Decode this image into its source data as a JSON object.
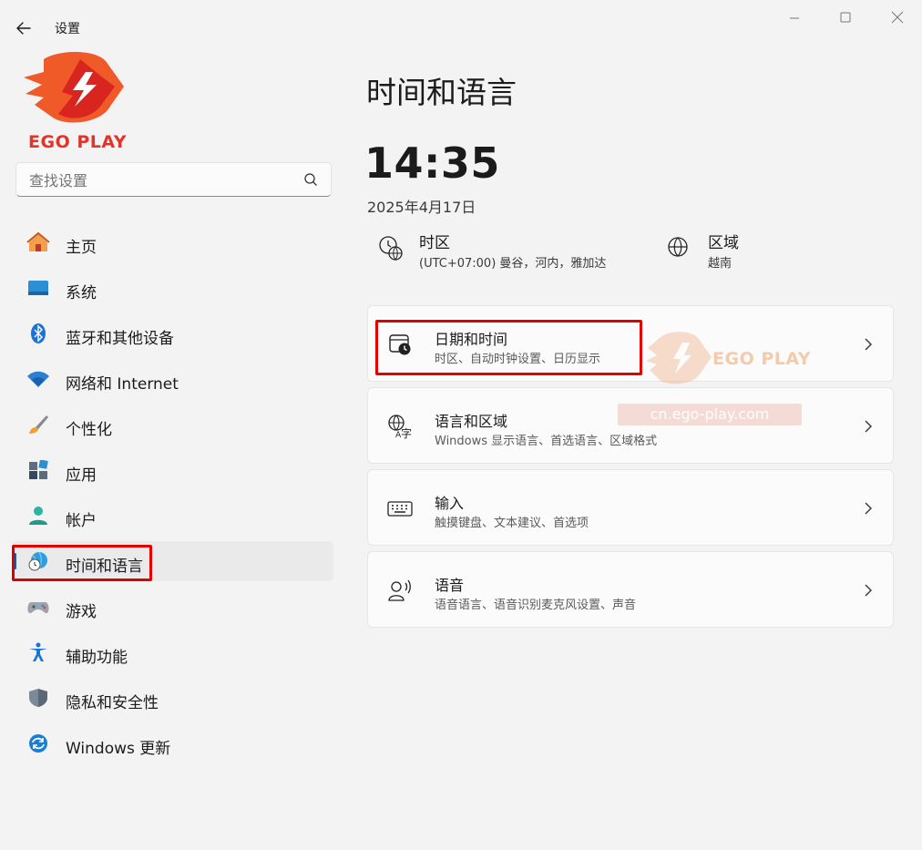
{
  "window": {
    "title": "设置",
    "controls": [
      "minimize-icon",
      "maximize-icon",
      "close-icon"
    ]
  },
  "logo": {
    "text": "EGO PLAY"
  },
  "search": {
    "placeholder": "查找设置"
  },
  "sidebar": {
    "active_index": 7,
    "items": [
      {
        "label": "主页",
        "icon": "home-icon"
      },
      {
        "label": "系统",
        "icon": "system-display-icon"
      },
      {
        "label": "蓝牙和其他设备",
        "icon": "bluetooth-icon"
      },
      {
        "label": "网络和 Internet",
        "icon": "wifi-icon"
      },
      {
        "label": "个性化",
        "icon": "brush-icon"
      },
      {
        "label": "应用",
        "icon": "apps-icon"
      },
      {
        "label": "帐户",
        "icon": "account-icon"
      },
      {
        "label": "时间和语言",
        "icon": "globe-clock-icon"
      },
      {
        "label": "游戏",
        "icon": "gamepad-icon"
      },
      {
        "label": "辅助功能",
        "icon": "accessibility-icon"
      },
      {
        "label": "隐私和安全性",
        "icon": "shield-icon"
      },
      {
        "label": "Windows 更新",
        "icon": "update-icon"
      }
    ]
  },
  "main": {
    "title": "时间和语言",
    "time": "14:35",
    "date": "2025年4月17日",
    "timezone": {
      "title": "时区",
      "value": "(UTC+07:00) 曼谷，河内，雅加达"
    },
    "region": {
      "title": "区域",
      "value": "越南"
    },
    "cards": [
      {
        "title": "日期和时间",
        "desc": "时区、自动时钟设置、日历显示",
        "icon": "calendar-clock-icon"
      },
      {
        "title": "语言和区域",
        "desc": "Windows 显示语言、首选语言、区域格式",
        "icon": "language-icon"
      },
      {
        "title": "输入",
        "desc": "触摸键盘、文本建议、首选项",
        "icon": "keyboard-icon"
      },
      {
        "title": "语音",
        "desc": "语音语言、语音识别麦克风设置、声音",
        "icon": "speech-icon"
      }
    ]
  },
  "watermark": {
    "brand": "EGO PLAY",
    "url": "cn.ego-play.com"
  },
  "colors": {
    "accent": "#0063b1",
    "highlight": "#e00000",
    "brand": "#e3342a"
  }
}
